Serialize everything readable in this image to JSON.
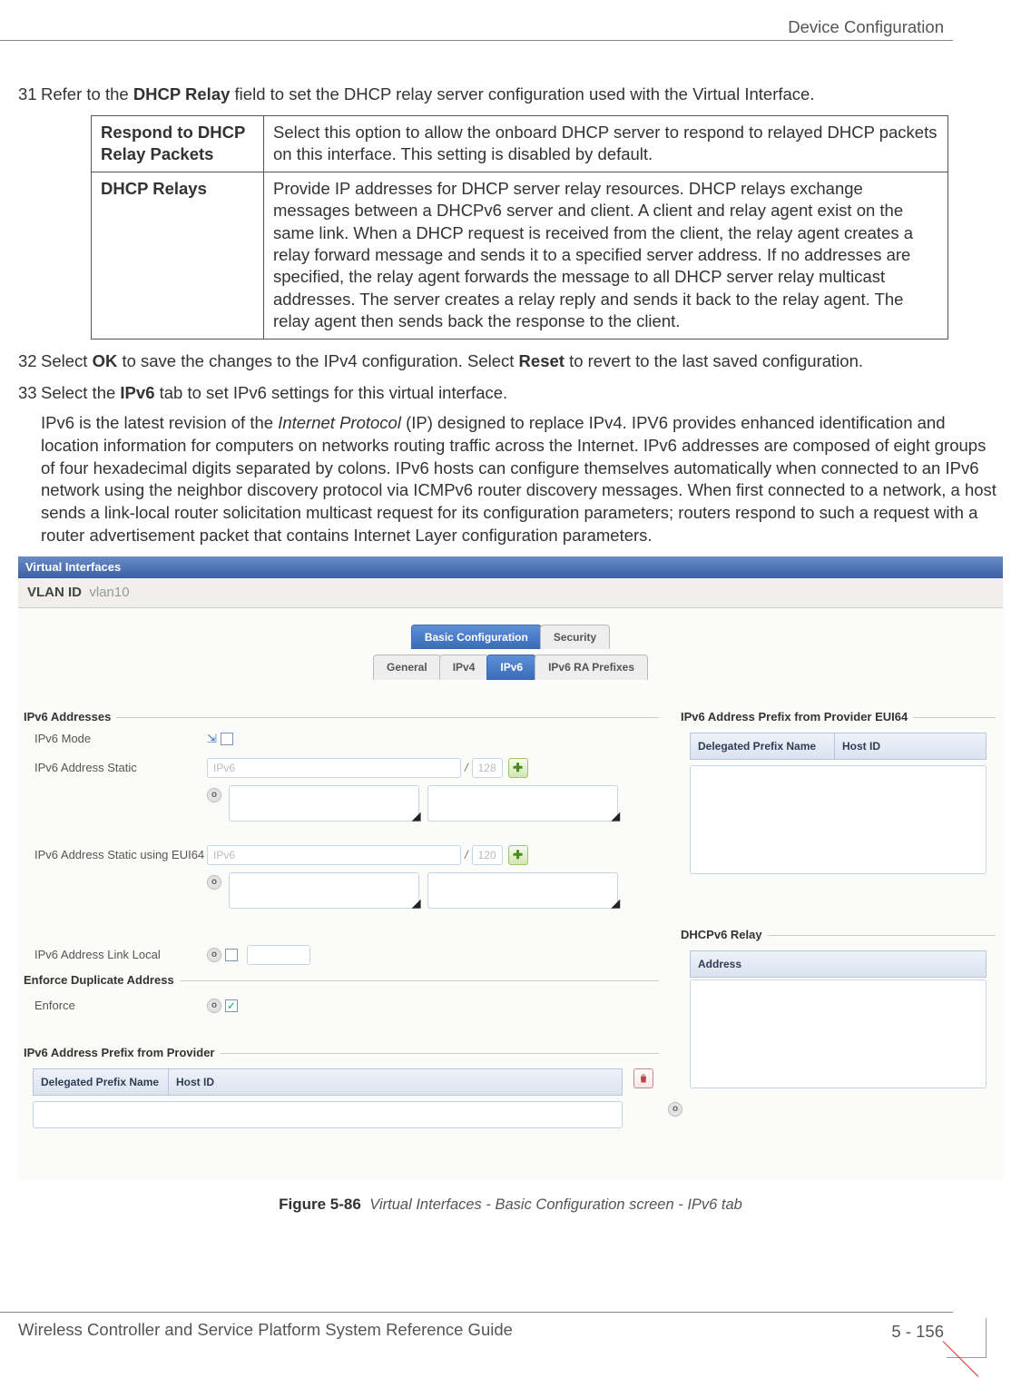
{
  "header_right": "Device Configuration",
  "steps": {
    "s31": {
      "num": "31",
      "pre": "Refer to the ",
      "bold": "DHCP Relay",
      "post": " field to set the DHCP relay server configuration used with the Virtual Interface."
    },
    "table": {
      "r1_label": "Respond to DHCP Relay Packets",
      "r1_text": "Select this option to allow the onboard DHCP server to respond to relayed DHCP packets on this interface. This setting is disabled by default.",
      "r2_label": "DHCP Relays",
      "r2_text": "Provide IP addresses for DHCP server relay resources. DHCP relays exchange messages between a DHCPv6 server and client. A client and relay agent exist on the same link. When a DHCP request is received from the client, the relay agent creates a relay forward message and sends it to a specified server address. If no addresses are specified, the relay agent forwards the message to all DHCP server relay multicast addresses. The server creates a relay reply and sends it back to the relay agent. The relay agent then sends back the response to the client."
    },
    "s32": {
      "num": "32",
      "p1": "Select ",
      "b1": "OK",
      "p2": " to save the changes to the IPv4 configuration. Select ",
      "b2": "Reset",
      "p3": " to revert to the last saved configuration."
    },
    "s33": {
      "num": "33",
      "p1": "Select the ",
      "b1": "IPv6",
      "p2": " tab to set IPv6 settings for this virtual interface."
    },
    "ipv6_para_a": "IPv6 is the latest revision of the ",
    "ipv6_para_i": "Internet Protocol",
    "ipv6_para_b": " (IP) designed to replace IPv4. IPV6 provides enhanced identification and location information for computers on networks routing traffic across the Internet. IPv6 addresses are composed of eight groups of four hexadecimal digits separated by colons. IPv6 hosts can configure themselves automatically when connected to an IPv6 network using the neighbor discovery protocol via ICMPv6 router discovery messages. When first connected to a network, a host sends a link-local router solicitation multicast request for its configuration parameters; routers respond to such a request with a router advertisement packet that contains Internet Layer configuration parameters."
  },
  "screenshot": {
    "window_title": "Virtual Interfaces",
    "vlan_label": "VLAN ID",
    "vlan_value": "vlan10",
    "tabs_top": {
      "basic": "Basic Configuration",
      "security": "Security"
    },
    "tabs_sub": {
      "general": "General",
      "ipv4": "IPv4",
      "ipv6": "IPv6",
      "ra": "IPv6 RA Prefixes"
    },
    "grp_addresses": "IPv6 Addresses",
    "lbl_mode": "IPv6 Mode",
    "lbl_static": "IPv6 Address Static",
    "ph_ipv6": "IPv6",
    "suffix_128": "128",
    "lbl_static_eui": "IPv6 Address Static using EUI64",
    "suffix_120": "120",
    "lbl_linklocal": "IPv6 Address Link Local",
    "grp_enforce": "Enforce Duplicate Address",
    "lbl_enforce": "Enforce",
    "grp_prefix_provider": "IPv6 Address Prefix from Provider",
    "col_delegated": "Delegated Prefix Name",
    "col_hostid": "Host ID",
    "grp_prefix_eui": "IPv6 Address Prefix from Provider EUI64",
    "grp_dhcpv6": "DHCPv6 Relay",
    "col_address": "Address"
  },
  "figure": {
    "label": "Figure 5-86",
    "caption": "Virtual Interfaces - Basic Configuration screen - IPv6 tab"
  },
  "footer_left": "Wireless Controller and Service Platform System Reference Guide",
  "footer_right": "5 - 156"
}
